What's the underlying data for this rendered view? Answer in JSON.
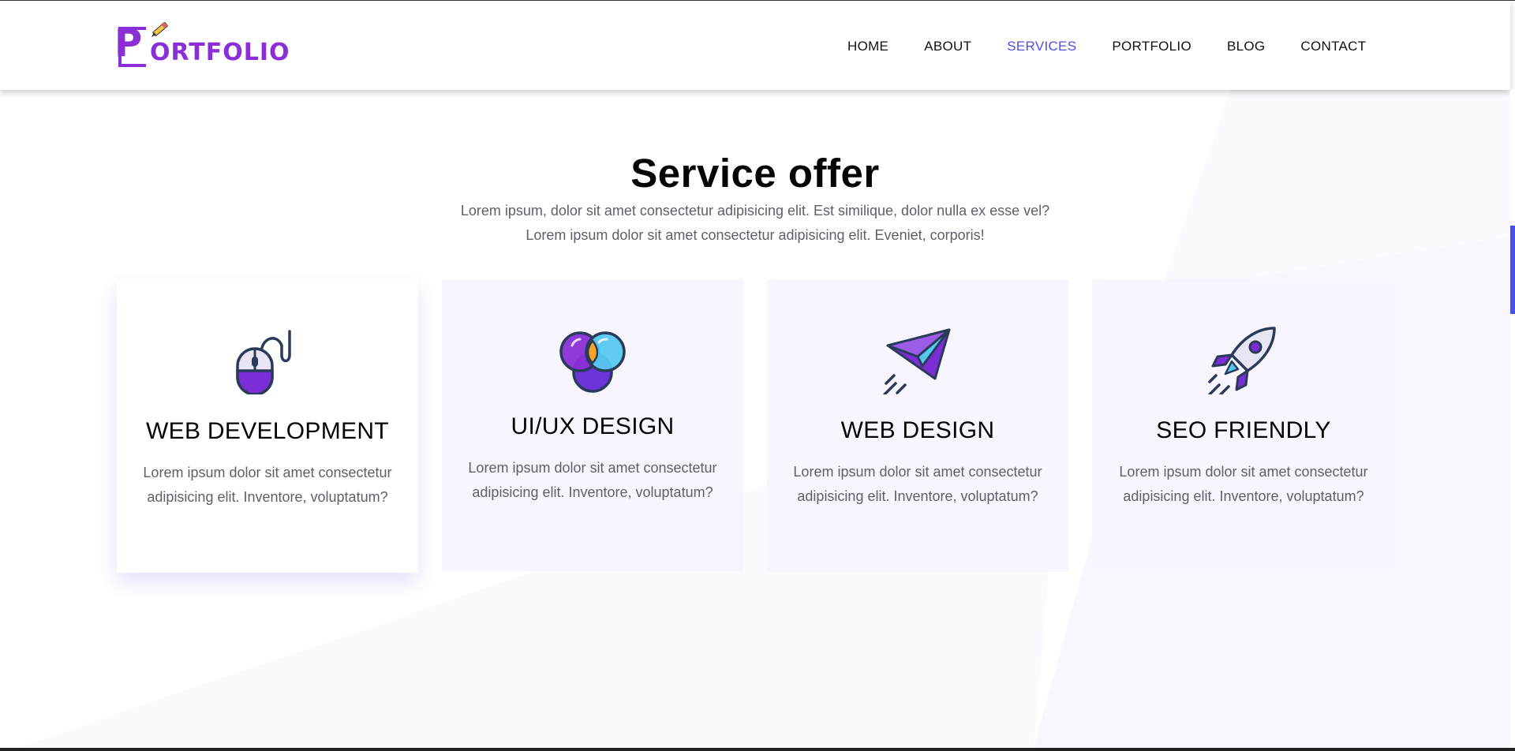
{
  "brand": {
    "logo_alt": "PORTFOLIO",
    "logo_initial": "P",
    "logo_rest": "ORTFOLIO",
    "accent": "#8a2fd8"
  },
  "nav": {
    "items": [
      {
        "label": "HOME",
        "active": false
      },
      {
        "label": "ABOUT",
        "active": false
      },
      {
        "label": "SERVICES",
        "active": true
      },
      {
        "label": "PORTFOLIO",
        "active": false
      },
      {
        "label": "BLOG",
        "active": false
      },
      {
        "label": "CONTACT",
        "active": false
      }
    ],
    "active_color": "#4d4fe0"
  },
  "services": {
    "title": "Service offer",
    "description_lines": [
      "Lorem ipsum, dolor sit amet consectetur adipisicing elit. Est similique, dolor nulla ex esse vel?",
      "Lorem ipsum dolor sit amet consectetur adipisicing elit. Eveniet, corporis!"
    ],
    "cards": [
      {
        "icon": "mouse-icon",
        "title": "WEB DEVELOPMENT",
        "text_lines": [
          "Lorem ipsum dolor sit amet consectetur",
          "adipisicing elit. Inventore, voluptatum?"
        ],
        "featured": true
      },
      {
        "icon": "venn-icon",
        "title": "UI/UX DESIGN",
        "text_lines": [
          "Lorem ipsum dolor sit amet consectetur",
          "adipisicing elit. Inventore, voluptatum?"
        ],
        "featured": false
      },
      {
        "icon": "paper-plane-icon",
        "title": "WEB DESIGN",
        "text_lines": [
          "Lorem ipsum dolor sit amet consectetur",
          "adipisicing elit. Inventore, voluptatum?"
        ],
        "featured": false
      },
      {
        "icon": "rocket-icon",
        "title": "SEO FRIENDLY",
        "text_lines": [
          "Lorem ipsum dolor sit amet consectetur",
          "adipisicing elit. Inventore, voluptatum?"
        ],
        "featured": false
      }
    ]
  },
  "colors": {
    "accent": "#4d4fe0",
    "purple": "#8a2fd8",
    "card_bg": "#f7f6fe",
    "text_muted": "#5f5f6b"
  }
}
